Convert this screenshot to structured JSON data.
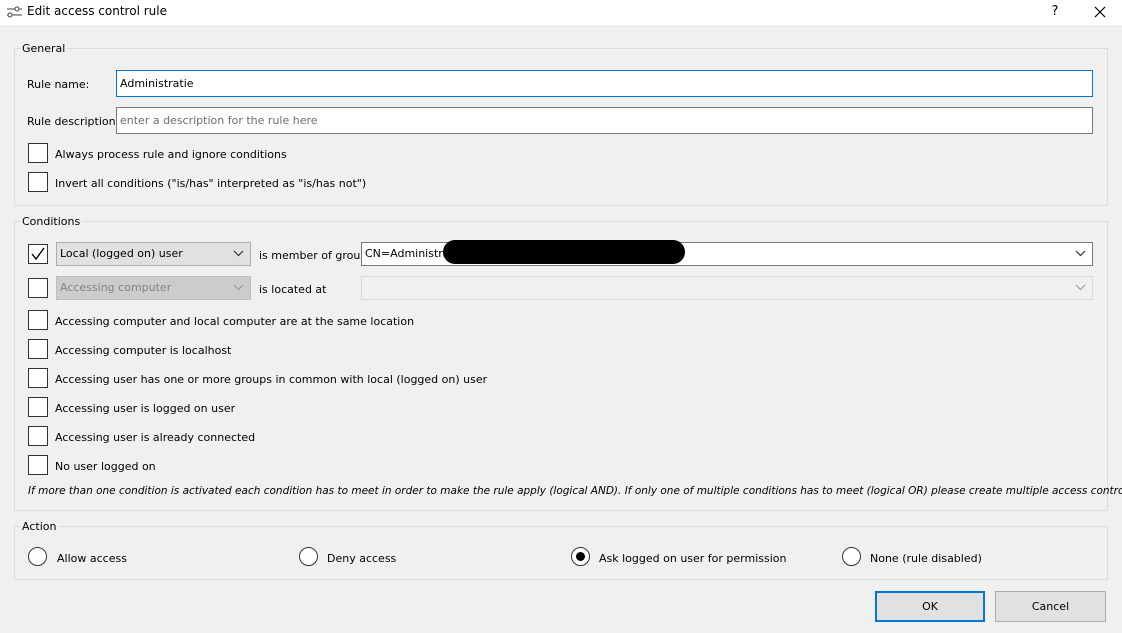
{
  "window": {
    "title": "Edit access control rule",
    "help_label": "?",
    "close_icon": "close-icon",
    "app_icon": "rule-settings-icon"
  },
  "general": {
    "group_label": "General",
    "rule_name_label": "Rule name:",
    "rule_name_value": "Administratie",
    "rule_description_label": "Rule description:",
    "rule_description_value": "",
    "rule_description_placeholder": "enter a description for the rule here",
    "always_process": {
      "label": "Always process rule and ignore conditions",
      "checked": false
    },
    "invert_conditions": {
      "label": "Invert all conditions (\"is/has\" interpreted as \"is/has not\")",
      "checked": false
    }
  },
  "conditions": {
    "group_label": "Conditions",
    "member_of_group": {
      "checked": true,
      "subject": "Local (logged on) user",
      "relation": "is member of group",
      "value": "CN=Administrati"
    },
    "located_at": {
      "checked": false,
      "subject": "Accessing computer",
      "relation": "is located at",
      "value": ""
    },
    "items": [
      {
        "label": "Accessing computer and local computer are at the same location",
        "checked": false
      },
      {
        "label": "Accessing computer is localhost",
        "checked": false
      },
      {
        "label": "Accessing user has one or more groups in common with local (logged on) user",
        "checked": false
      },
      {
        "label": "Accessing user is logged on user",
        "checked": false
      },
      {
        "label": "Accessing user is already connected",
        "checked": false
      },
      {
        "label": "No user logged on",
        "checked": false
      }
    ],
    "note": "If more than one condition is activated each condition has to meet in order to make the rule apply (logical AND). If only one of multiple conditions has to meet (logical OR) please create multiple access control rules."
  },
  "action": {
    "group_label": "Action",
    "options": [
      {
        "label": "Allow access",
        "selected": false
      },
      {
        "label": "Deny access",
        "selected": false
      },
      {
        "label": "Ask logged on user for permission",
        "selected": true
      },
      {
        "label": "None (rule disabled)",
        "selected": false
      }
    ]
  },
  "buttons": {
    "ok": "OK",
    "cancel": "Cancel"
  },
  "colors": {
    "accent": "#0078d7",
    "background": "#f0f0f0"
  }
}
